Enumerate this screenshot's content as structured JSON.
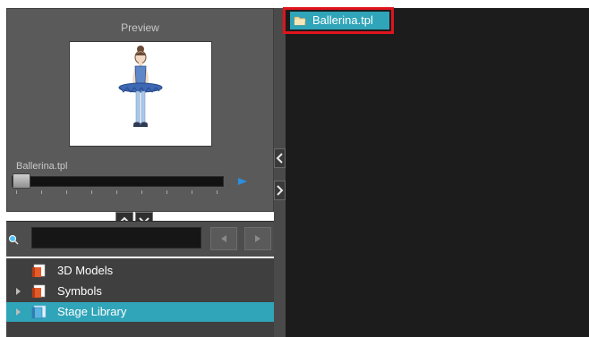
{
  "preview": {
    "title": "Preview",
    "template_name": "Ballerina.tpl"
  },
  "search": {
    "value": "",
    "placeholder": ""
  },
  "library_tree": {
    "items": [
      {
        "label": "3D Models",
        "expandable": false,
        "selected": false
      },
      {
        "label": "Symbols",
        "expandable": true,
        "selected": false
      },
      {
        "label": "Stage Library",
        "expandable": true,
        "selected": true
      }
    ]
  },
  "content_view": {
    "items": [
      {
        "label": "Ballerina.tpl",
        "selected": true,
        "highlighted": true
      }
    ]
  },
  "colors": {
    "selection": "#30a4b8",
    "highlight_outline": "#e0141d",
    "panel_dark": "#1c1c1c"
  },
  "icons": {
    "search": "search-icon",
    "folder": "folder-icon",
    "library": "library-folder-icon",
    "template": "template-icon",
    "play": "play-icon"
  }
}
